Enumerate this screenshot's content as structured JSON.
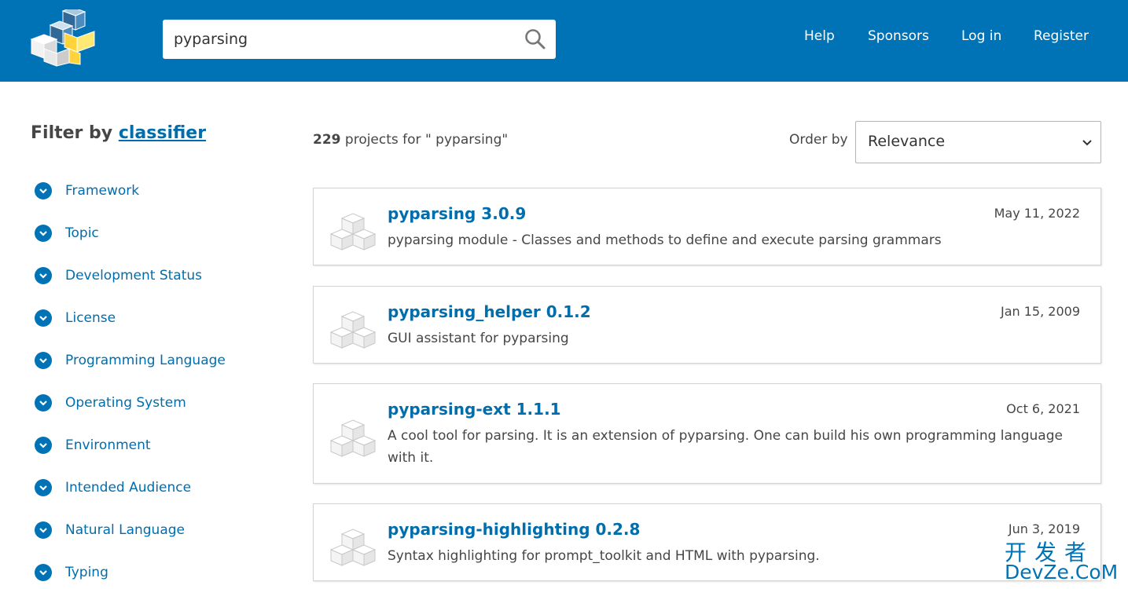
{
  "header": {
    "search_value": "pyparsing",
    "nav": [
      "Help",
      "Sponsors",
      "Log in",
      "Register"
    ]
  },
  "sidebar": {
    "title_prefix": "Filter by",
    "title_link": "classifier",
    "items": [
      {
        "label": "Framework"
      },
      {
        "label": "Topic"
      },
      {
        "label": "Development Status"
      },
      {
        "label": "License"
      },
      {
        "label": "Programming Language"
      },
      {
        "label": "Operating System"
      },
      {
        "label": "Environment"
      },
      {
        "label": "Intended Audience"
      },
      {
        "label": "Natural Language"
      },
      {
        "label": "Typing"
      }
    ]
  },
  "results": {
    "count": "229",
    "count_text": "projects for \" pyparsing\"",
    "order_label": "Order by",
    "order_value": "Relevance",
    "items": [
      {
        "name": "pyparsing 3.0.9",
        "date": "May 11, 2022",
        "description": "pyparsing module - Classes and methods to define and execute parsing grammars"
      },
      {
        "name": "pyparsing_helper 0.1.2",
        "date": "Jan 15, 2009",
        "description": "GUI assistant for pyparsing"
      },
      {
        "name": "pyparsing-ext 1.1.1",
        "date": "Oct 6, 2021",
        "description": "A cool tool for parsing. It is an extension of pyparsing. One can build his own programming language with it."
      },
      {
        "name": "pyparsing-highlighting 0.2.8",
        "date": "Jun 3, 2019",
        "description": "Syntax highlighting for prompt_toolkit and HTML with pyparsing."
      }
    ]
  },
  "watermark": {
    "cn": "开发者",
    "en": "DevZe.CoM"
  },
  "colors": {
    "header": "#0073b7",
    "link": "#006dad",
    "text": "#464646"
  }
}
